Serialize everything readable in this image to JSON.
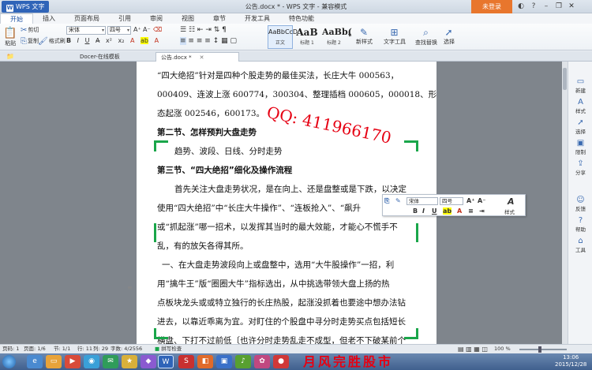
{
  "titlebar": {
    "app_name": "WPS 文字",
    "window_title": "公告.docx * - WPS 文字 - 兼容模式",
    "login": "未登录"
  },
  "tabs": [
    "开始",
    "插入",
    "页面布局",
    "引用",
    "审阅",
    "视图",
    "章节",
    "开发工具",
    "特色功能"
  ],
  "ribbon": {
    "cut": "剪切",
    "paste": "粘贴",
    "copy": "复制",
    "format_painter": "格式刷",
    "font_name": "宋体",
    "font_size": "四号",
    "styles": [
      {
        "sample": "AaBbCcD",
        "name": "正文"
      },
      {
        "sample": "AaB",
        "name": "标题 1"
      },
      {
        "sample": "AaBb(",
        "name": "标题 2"
      }
    ],
    "new_style": "新样式",
    "text_tools": "文字工具",
    "find_replace": "查找替换",
    "select": "选择"
  },
  "doc_tabs": [
    "Docer-在线模板",
    "公告.docx *"
  ],
  "document": {
    "lines": [
      "“四大绝招”针对是四种个股走势的最佳买法，长庄大牛 000563，",
      "000409、连波上涨 600774，300304、整理插档 000605，000018、形",
      "态起涨 002546，600173。",
      "第二节、怎样预判大盘走势",
      "趋势、波段、日线、分时走势",
      "第三节、“四大绝招”细化及操作流程",
      "首先关注大盘走势状况，是在向上、还是盘整或是下跌，以决定",
      "使用“四大绝招”中“长庄大牛操作”、“连板抢入”、“飙升",
      "或“抓起涨”哪一招术，以发挥其当时的最大效能，才能心不慌手不",
      "乱，有的放矢各得其所。",
      "一、在大盘走势波段向上或盘整中，选用“大牛股操作”一招，利",
      "用“擒牛王”版“圈圈大牛”指标选出，从中挑选带领大盘上扬的热",
      "点板块龙头或或特立独行的长庄热股，起涨没抓着也要途中想办法钻",
      "进去，以靠近乖离为宜。对盯住的个股盘中寻分时走势买点包括短长",
      "横盘、下打不过前低〔也许分时走势乱走不成型，但老不下破某前个"
    ],
    "watermark": "QQ: 411966170"
  },
  "mini_toolbar": {
    "font_name": "宋体",
    "font_size": "四号",
    "styles": "样式"
  },
  "side_panel": [
    "新建",
    "样式",
    "选择",
    "限制",
    "分享",
    "反馈",
    "帮助",
    "工具"
  ],
  "statusbar": {
    "page_num": "页码: 1",
    "pages": "页面: 1/6",
    "section": "节: 1/1",
    "row": "行: 11",
    "col": "列: 29",
    "words": "字数: 4/2556",
    "spell": "拼写检查",
    "zoom": "100 %"
  },
  "taskbar": {
    "banner": "月风完胜股市",
    "time": "13:06",
    "date": "2015/12/28"
  }
}
